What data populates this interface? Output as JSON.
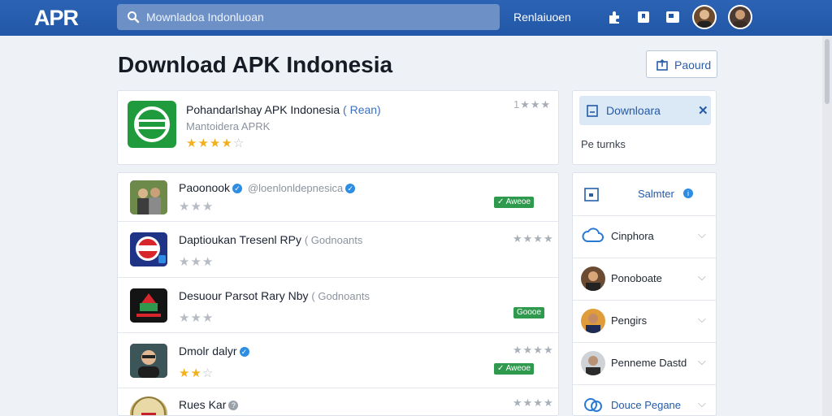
{
  "app": {
    "logo": "APR"
  },
  "search": {
    "text": "Mownladoa Indonluoan"
  },
  "topbar": {
    "nav_label": "Renlaiuoen"
  },
  "page": {
    "title": "Download APK Indonesia",
    "report_label": "Paourd"
  },
  "featured": {
    "title": "Pohandarlshay APK Indonesia",
    "tag": "( Rean)",
    "subtitle": "Mantoidera APRK",
    "rating": "1★★★",
    "stars": 4
  },
  "list": [
    {
      "name": "Paoonook",
      "handle": "@loenlonldepnesica",
      "rating": "",
      "badge": "✓ Aweoe",
      "verified": true,
      "stars": 0
    },
    {
      "name": "Daptioukan Tresenl RPy",
      "handle": "( Godnoants",
      "rating": "★★★★",
      "badge": "",
      "verified": false,
      "stars": 0
    },
    {
      "name": "Desuour Parsot Rary Nby",
      "handle": "( Godnoants",
      "rating": "",
      "badge": "Goooe",
      "verified": false,
      "stars": 0
    },
    {
      "name": "Dmolr dalyr",
      "handle": "",
      "rating": "★★★★",
      "badge": "✓ Aweoe",
      "verified": true,
      "stars": 2
    },
    {
      "name": "Rues Kar",
      "handle": "",
      "rating": "★★★★",
      "badge": "",
      "verified": false,
      "stars": 0
    }
  ],
  "side": {
    "download_label": "Downloara",
    "close": "✕",
    "text": "Pe turnks",
    "section_label": "Salmter",
    "items": [
      {
        "label": "Cinphora"
      },
      {
        "label": "Ponoboate"
      },
      {
        "label": "Pengirs"
      },
      {
        "label": "Penneme Dastd"
      },
      {
        "label": "Douce Pegane"
      }
    ]
  },
  "colors": {
    "brand": "#2257a7",
    "accent": "#2d8de3",
    "success": "#2f9a4d",
    "star": "#f2b01e"
  }
}
